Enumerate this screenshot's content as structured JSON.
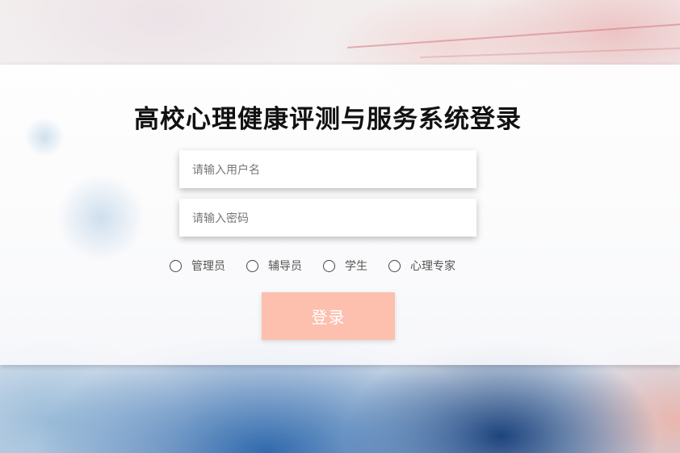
{
  "page": {
    "title": "高校心理健康评测与服务系统登录"
  },
  "form": {
    "username_placeholder": "请输入用户名",
    "password_placeholder": "请输入密码",
    "roles": [
      {
        "label": "管理员",
        "selected": false
      },
      {
        "label": "辅导员",
        "selected": false
      },
      {
        "label": "学生",
        "selected": false
      },
      {
        "label": "心理专家",
        "selected": false
      }
    ],
    "login_label": "登录"
  },
  "colors": {
    "login_button": "#fdbfae",
    "title_text": "#111111"
  }
}
